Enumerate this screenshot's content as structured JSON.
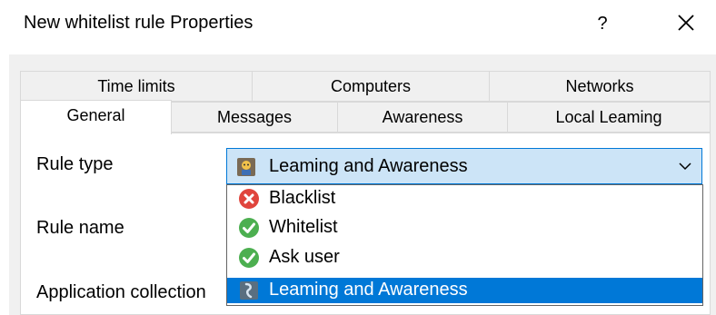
{
  "window": {
    "title": "New whitelist rule Properties",
    "help_label": "?"
  },
  "tabs_row1": [
    {
      "label": "Time limits"
    },
    {
      "label": "Computers"
    },
    {
      "label": "Networks"
    }
  ],
  "tabs_row2": [
    {
      "label": "General",
      "active": true
    },
    {
      "label": "Messages"
    },
    {
      "label": "Awareness"
    },
    {
      "label": "Local Leaming"
    }
  ],
  "form": {
    "rule_type_label": "Rule type",
    "rule_name_label": "Rule name",
    "app_collection_label": "Application collection",
    "rule_type_value": "Leaming and Awareness",
    "rule_type_icon": "learning-awareness-icon"
  },
  "dropdown": {
    "options": [
      {
        "label": "Blacklist",
        "icon": "blacklist-icon"
      },
      {
        "label": "Whitelist",
        "icon": "whitelist-icon"
      },
      {
        "label": "Ask user",
        "icon": "ask-user-icon"
      },
      {
        "label": "Leaming and Awareness",
        "icon": "learning-awareness-icon",
        "selected": true
      }
    ]
  },
  "colors": {
    "accent": "#0078d7",
    "combo_bg": "#cce4f7",
    "panel_bg": "#f0f0f0",
    "blacklist_red": "#e0453d",
    "whitelist_green": "#4caf50"
  }
}
